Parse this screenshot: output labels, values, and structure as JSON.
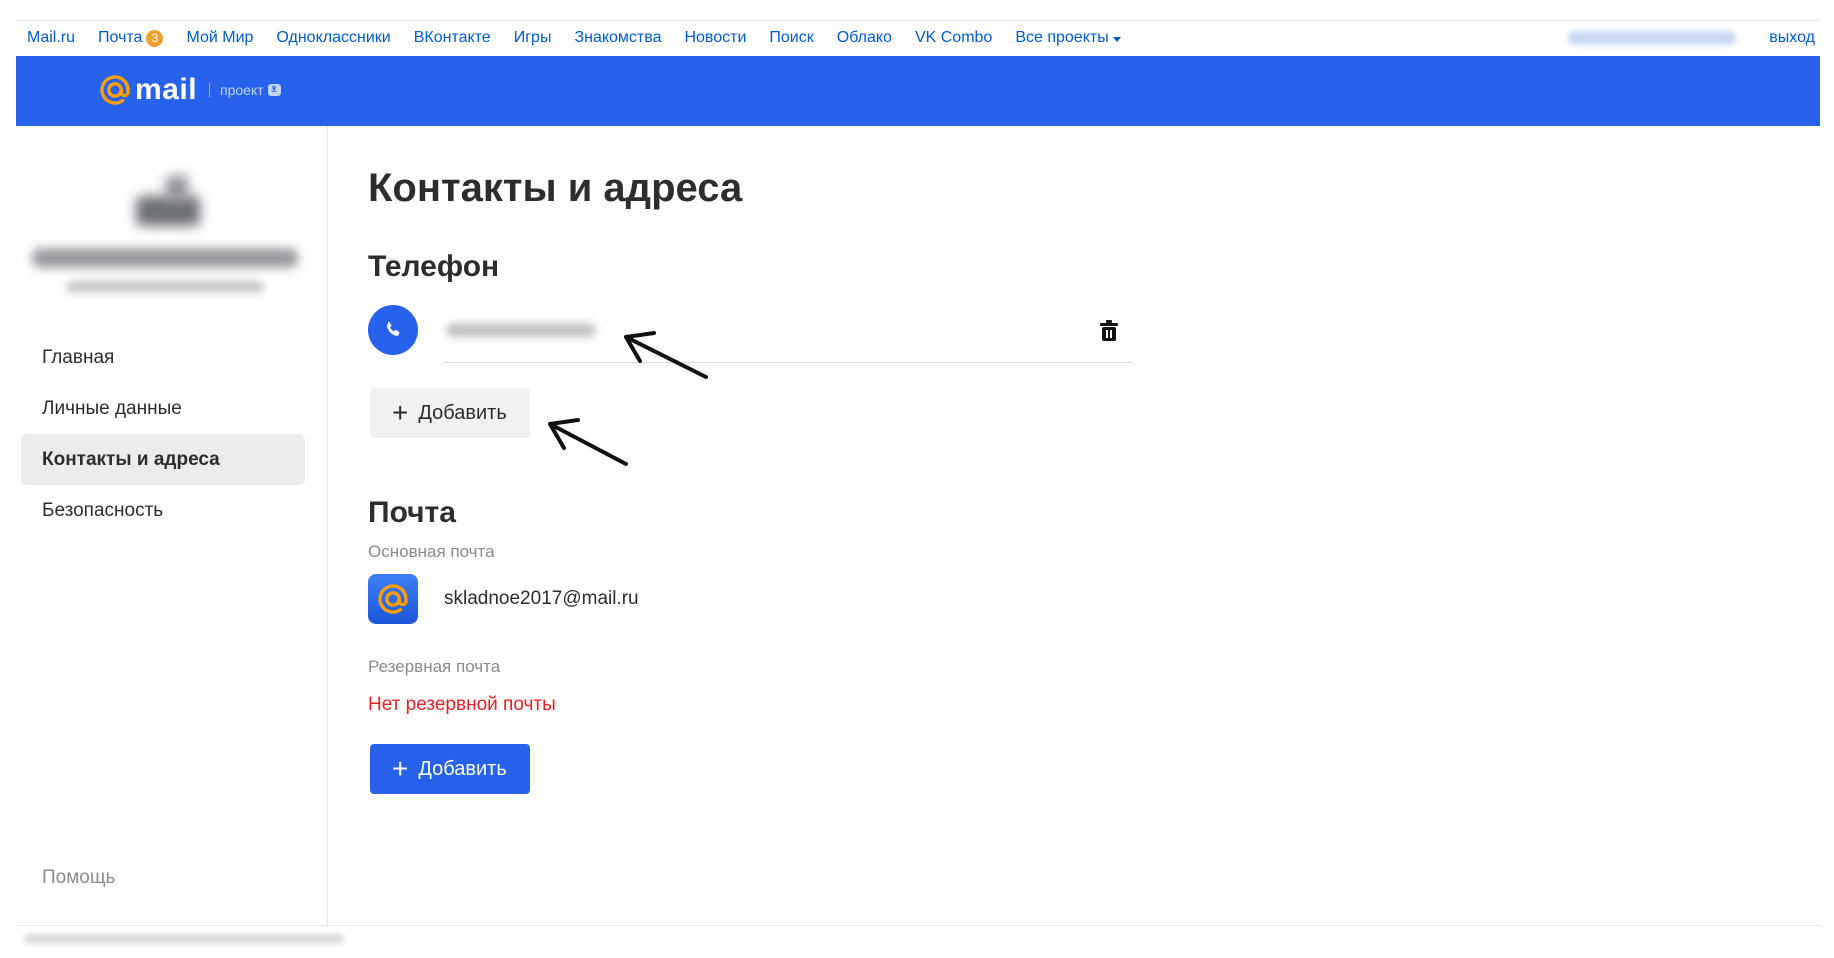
{
  "topnav": {
    "links": [
      {
        "label": "Mail.ru"
      },
      {
        "label": "Почта",
        "badge": "3"
      },
      {
        "label": "Мой Мир"
      },
      {
        "label": "Одноклассники"
      },
      {
        "label": "ВКонтакте"
      },
      {
        "label": "Игры"
      },
      {
        "label": "Знакомства"
      },
      {
        "label": "Новости"
      },
      {
        "label": "Поиск"
      },
      {
        "label": "Облако"
      },
      {
        "label": "VK Combo"
      },
      {
        "label": "Все проекты"
      }
    ],
    "logout": "выход"
  },
  "header": {
    "logo_word": "mail",
    "project_label": "проект",
    "color": "#2662ec"
  },
  "sidebar": {
    "menu": [
      {
        "label": "Главная"
      },
      {
        "label": "Личные данные"
      },
      {
        "label": "Контакты и адреса",
        "active": true
      },
      {
        "label": "Безопасность"
      }
    ],
    "help": "Помощь"
  },
  "main": {
    "title": "Контакты и адреса",
    "phone_section": {
      "heading": "Телефон",
      "add_label": "Добавить",
      "icon": "phone-icon",
      "delete_icon": "trash-icon"
    },
    "mail_section": {
      "heading": "Почта",
      "primary_label": "Основная почта",
      "primary_email": "skladnoe2017@mail.ru",
      "backup_label": "Резервная почта",
      "no_backup": "Нет резервной почты",
      "add_label": "Добавить"
    }
  },
  "colors": {
    "accent": "#2662ec",
    "link": "#005bd1",
    "badge": "#f0a02e",
    "error": "#e8202a"
  }
}
